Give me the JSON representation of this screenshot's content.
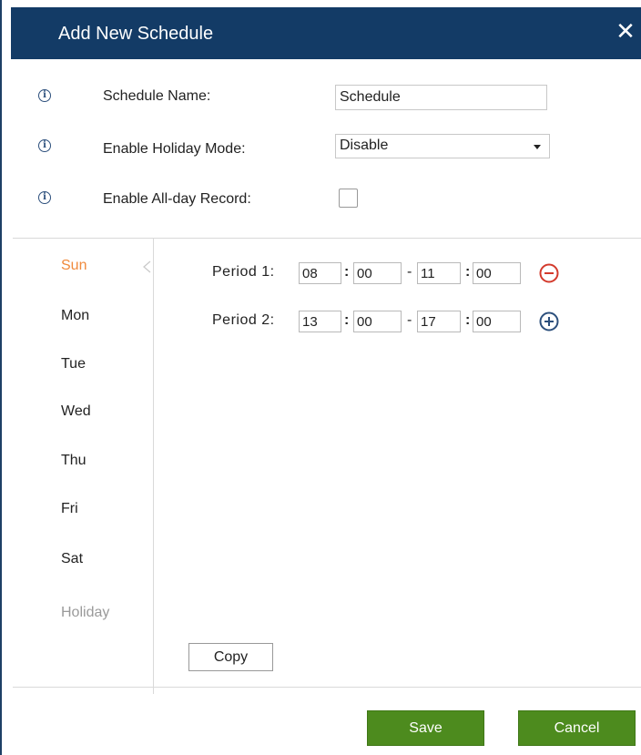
{
  "dialog": {
    "title": "Add New Schedule",
    "close_glyph": "✕"
  },
  "form": {
    "schedule_name": {
      "label": "Schedule Name:",
      "value": "Schedule",
      "icon": "info-icon"
    },
    "holiday_mode": {
      "label": "Enable Holiday Mode:",
      "value": "Disable",
      "icon": "info-icon"
    },
    "allday_record": {
      "label": "Enable All-day Record:",
      "checked": false,
      "icon": "info-icon"
    }
  },
  "days": {
    "active": "Sun",
    "items": [
      {
        "label": "Sun",
        "state": "active"
      },
      {
        "label": "Mon",
        "state": "normal"
      },
      {
        "label": "Tue",
        "state": "normal"
      },
      {
        "label": "Wed",
        "state": "normal"
      },
      {
        "label": "Thu",
        "state": "normal"
      },
      {
        "label": "Fri",
        "state": "normal"
      },
      {
        "label": "Sat",
        "state": "normal"
      },
      {
        "label": "Holiday",
        "state": "disabled"
      }
    ]
  },
  "periods": [
    {
      "label": "Period 1:",
      "start_hour": "08",
      "start_min": "00",
      "end_hour": "11",
      "end_min": "00",
      "action_icon": "minus-circle-icon"
    },
    {
      "label": "Period 2:",
      "start_hour": "13",
      "start_min": "00",
      "end_hour": "17",
      "end_min": "00",
      "action_icon": "plus-circle-icon"
    }
  ],
  "separators": {
    "colon": ":",
    "dash": "-"
  },
  "buttons": {
    "copy": "Copy",
    "save": "Save",
    "cancel": "Cancel"
  },
  "colors": {
    "header_bg": "#133b66",
    "active_day": "#f08a3c",
    "disabled_day": "#9a9a9a",
    "remove_icon": "#d33a2c",
    "add_icon": "#2c4f7c",
    "button_green": "#4d8b1e"
  }
}
